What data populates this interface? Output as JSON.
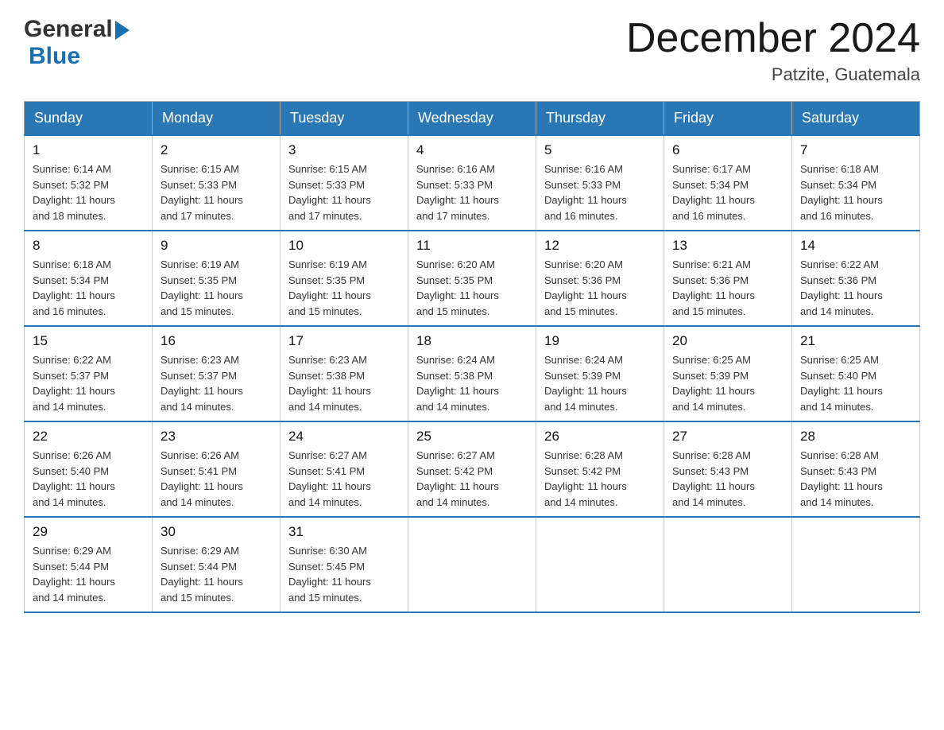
{
  "header": {
    "logo_general": "General",
    "logo_blue": "Blue",
    "month_title": "December 2024",
    "subtitle": "Patzite, Guatemala"
  },
  "weekdays": [
    "Sunday",
    "Monday",
    "Tuesday",
    "Wednesday",
    "Thursday",
    "Friday",
    "Saturday"
  ],
  "weeks": [
    [
      {
        "day": "1",
        "sunrise": "6:14 AM",
        "sunset": "5:32 PM",
        "daylight": "11 hours and 18 minutes."
      },
      {
        "day": "2",
        "sunrise": "6:15 AM",
        "sunset": "5:33 PM",
        "daylight": "11 hours and 17 minutes."
      },
      {
        "day": "3",
        "sunrise": "6:15 AM",
        "sunset": "5:33 PM",
        "daylight": "11 hours and 17 minutes."
      },
      {
        "day": "4",
        "sunrise": "6:16 AM",
        "sunset": "5:33 PM",
        "daylight": "11 hours and 17 minutes."
      },
      {
        "day": "5",
        "sunrise": "6:16 AM",
        "sunset": "5:33 PM",
        "daylight": "11 hours and 16 minutes."
      },
      {
        "day": "6",
        "sunrise": "6:17 AM",
        "sunset": "5:34 PM",
        "daylight": "11 hours and 16 minutes."
      },
      {
        "day": "7",
        "sunrise": "6:18 AM",
        "sunset": "5:34 PM",
        "daylight": "11 hours and 16 minutes."
      }
    ],
    [
      {
        "day": "8",
        "sunrise": "6:18 AM",
        "sunset": "5:34 PM",
        "daylight": "11 hours and 16 minutes."
      },
      {
        "day": "9",
        "sunrise": "6:19 AM",
        "sunset": "5:35 PM",
        "daylight": "11 hours and 15 minutes."
      },
      {
        "day": "10",
        "sunrise": "6:19 AM",
        "sunset": "5:35 PM",
        "daylight": "11 hours and 15 minutes."
      },
      {
        "day": "11",
        "sunrise": "6:20 AM",
        "sunset": "5:35 PM",
        "daylight": "11 hours and 15 minutes."
      },
      {
        "day": "12",
        "sunrise": "6:20 AM",
        "sunset": "5:36 PM",
        "daylight": "11 hours and 15 minutes."
      },
      {
        "day": "13",
        "sunrise": "6:21 AM",
        "sunset": "5:36 PM",
        "daylight": "11 hours and 15 minutes."
      },
      {
        "day": "14",
        "sunrise": "6:22 AM",
        "sunset": "5:36 PM",
        "daylight": "11 hours and 14 minutes."
      }
    ],
    [
      {
        "day": "15",
        "sunrise": "6:22 AM",
        "sunset": "5:37 PM",
        "daylight": "11 hours and 14 minutes."
      },
      {
        "day": "16",
        "sunrise": "6:23 AM",
        "sunset": "5:37 PM",
        "daylight": "11 hours and 14 minutes."
      },
      {
        "day": "17",
        "sunrise": "6:23 AM",
        "sunset": "5:38 PM",
        "daylight": "11 hours and 14 minutes."
      },
      {
        "day": "18",
        "sunrise": "6:24 AM",
        "sunset": "5:38 PM",
        "daylight": "11 hours and 14 minutes."
      },
      {
        "day": "19",
        "sunrise": "6:24 AM",
        "sunset": "5:39 PM",
        "daylight": "11 hours and 14 minutes."
      },
      {
        "day": "20",
        "sunrise": "6:25 AM",
        "sunset": "5:39 PM",
        "daylight": "11 hours and 14 minutes."
      },
      {
        "day": "21",
        "sunrise": "6:25 AM",
        "sunset": "5:40 PM",
        "daylight": "11 hours and 14 minutes."
      }
    ],
    [
      {
        "day": "22",
        "sunrise": "6:26 AM",
        "sunset": "5:40 PM",
        "daylight": "11 hours and 14 minutes."
      },
      {
        "day": "23",
        "sunrise": "6:26 AM",
        "sunset": "5:41 PM",
        "daylight": "11 hours and 14 minutes."
      },
      {
        "day": "24",
        "sunrise": "6:27 AM",
        "sunset": "5:41 PM",
        "daylight": "11 hours and 14 minutes."
      },
      {
        "day": "25",
        "sunrise": "6:27 AM",
        "sunset": "5:42 PM",
        "daylight": "11 hours and 14 minutes."
      },
      {
        "day": "26",
        "sunrise": "6:28 AM",
        "sunset": "5:42 PM",
        "daylight": "11 hours and 14 minutes."
      },
      {
        "day": "27",
        "sunrise": "6:28 AM",
        "sunset": "5:43 PM",
        "daylight": "11 hours and 14 minutes."
      },
      {
        "day": "28",
        "sunrise": "6:28 AM",
        "sunset": "5:43 PM",
        "daylight": "11 hours and 14 minutes."
      }
    ],
    [
      {
        "day": "29",
        "sunrise": "6:29 AM",
        "sunset": "5:44 PM",
        "daylight": "11 hours and 14 minutes."
      },
      {
        "day": "30",
        "sunrise": "6:29 AM",
        "sunset": "5:44 PM",
        "daylight": "11 hours and 15 minutes."
      },
      {
        "day": "31",
        "sunrise": "6:30 AM",
        "sunset": "5:45 PM",
        "daylight": "11 hours and 15 minutes."
      },
      null,
      null,
      null,
      null
    ]
  ],
  "labels": {
    "sunrise": "Sunrise:",
    "sunset": "Sunset:",
    "daylight": "Daylight:"
  }
}
